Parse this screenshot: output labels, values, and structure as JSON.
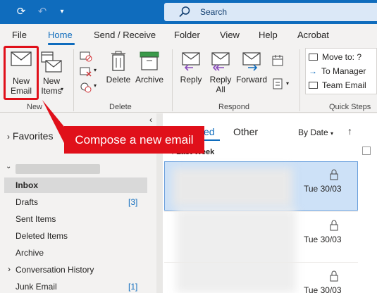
{
  "search": {
    "label": "Search"
  },
  "tabs": [
    "File",
    "Home",
    "Send / Receive",
    "Folder",
    "View",
    "Help",
    "Acrobat"
  ],
  "ribbon": {
    "new_email": "New\nEmail",
    "new_email_l1": "New",
    "new_email_l2": "Email",
    "new_items_l1": "New",
    "new_items_l2": "Items",
    "delete": "Delete",
    "archive": "Archive",
    "reply": "Reply",
    "reply_all_l1": "Reply",
    "reply_all_l2": "All",
    "forward": "Forward",
    "quicksteps": [
      "Move to: ?",
      "To Manager",
      "Team Email"
    ],
    "groups": {
      "new": "New",
      "delete": "Delete",
      "respond": "Respond",
      "quick_steps": "Quick Steps"
    }
  },
  "callout": "Compose a new email",
  "left": {
    "favorites": "Favorites",
    "folders": [
      {
        "name": "Inbox",
        "count": ""
      },
      {
        "name": "Drafts",
        "count": "[3]"
      },
      {
        "name": "Sent Items",
        "count": ""
      },
      {
        "name": "Deleted Items",
        "count": ""
      },
      {
        "name": "Archive",
        "count": ""
      },
      {
        "name": "Conversation History",
        "count": ""
      },
      {
        "name": "Junk Email",
        "count": "[1]"
      }
    ]
  },
  "middle": {
    "focused_partial": "ed",
    "other": "Other",
    "sort": "By Date",
    "group_header": "Last Week",
    "dates": [
      "Tue 30/03",
      "Tue 30/03",
      "Tue 30/03"
    ]
  },
  "colors": {
    "accent": "#0f6cbd",
    "callout": "#e0101a"
  }
}
